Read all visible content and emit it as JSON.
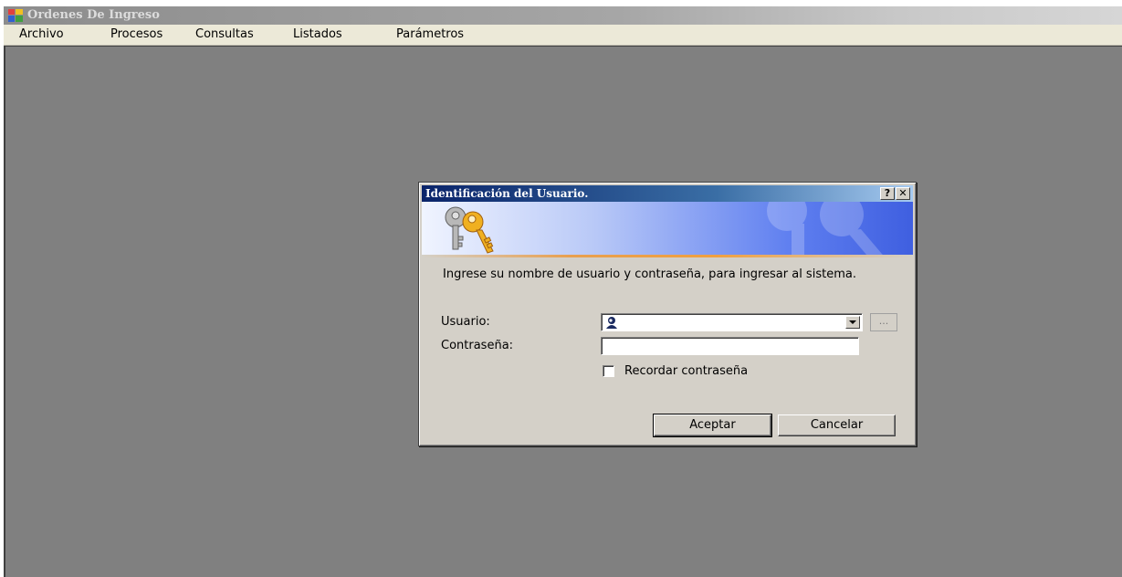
{
  "window": {
    "title": "Ordenes De Ingreso"
  },
  "menu": {
    "items": [
      "Archivo",
      "Procesos",
      "Consultas",
      "Listados",
      "Parámetros"
    ]
  },
  "dialog": {
    "title": "Identificación del Usuario.",
    "help_button": "?",
    "close_button": "✕",
    "instructions": "Ingrese su nombre de usuario y contraseña, para ingresar al sistema.",
    "user_label": "Usuario:",
    "user_value": "",
    "browse_label": "...",
    "password_label": "Contraseña:",
    "password_value": "",
    "remember_label": "Recordar contraseña",
    "remember_checked": false,
    "ok_label": "Aceptar",
    "cancel_label": "Cancelar"
  },
  "colors": {
    "mdi_background": "#808080",
    "dialog_face": "#d4d0c8",
    "dialog_title_start": "#0a246a",
    "dialog_title_end": "#a6caf0"
  },
  "icons": [
    "app-icon",
    "keys-icon",
    "user-avatar-icon",
    "chevron-down-icon"
  ]
}
